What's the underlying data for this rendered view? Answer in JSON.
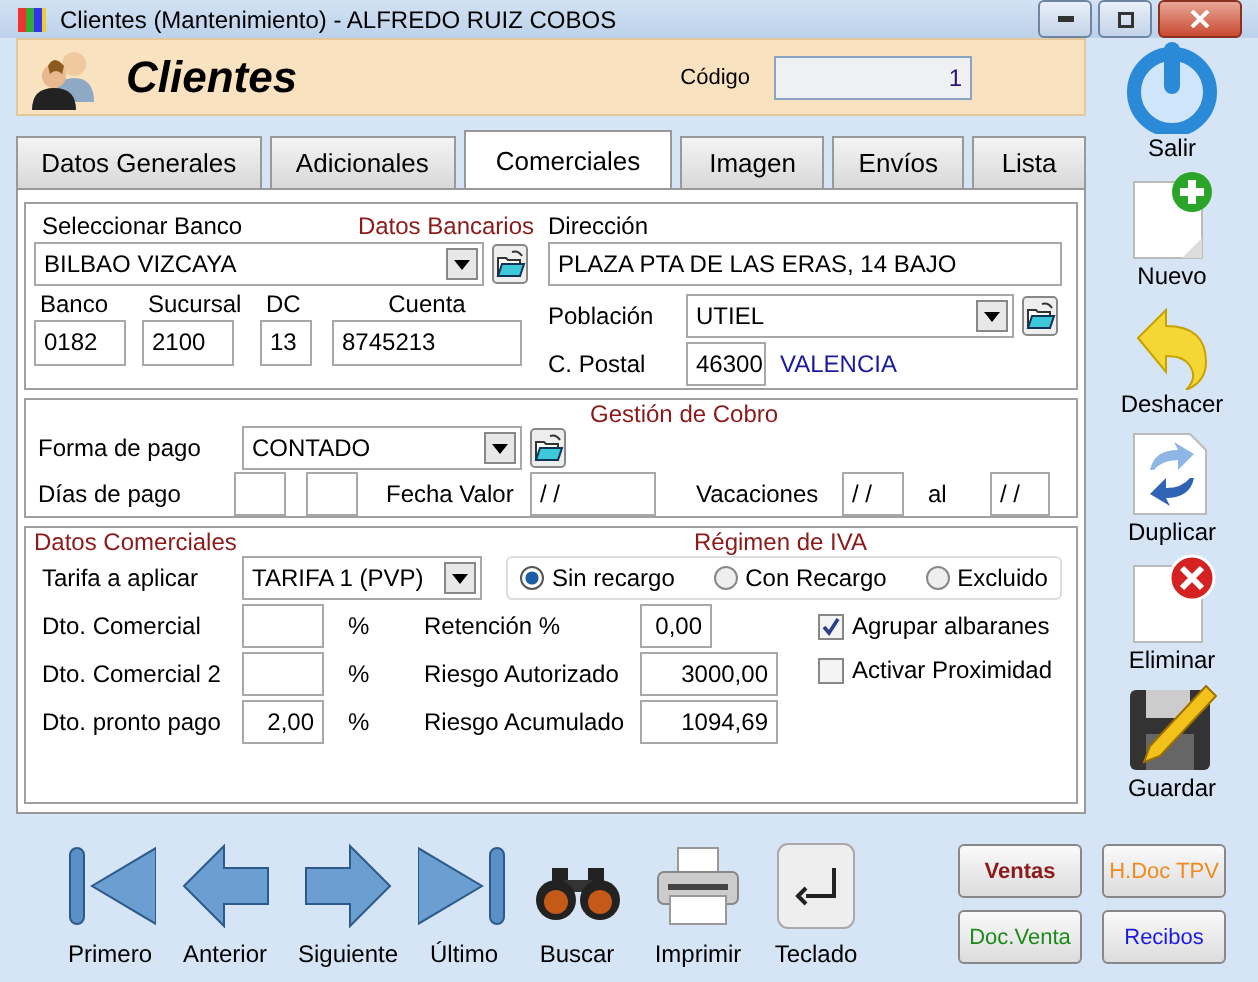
{
  "window": {
    "title": "Clientes (Mantenimiento) - ALFREDO RUIZ COBOS"
  },
  "header": {
    "title": "Clientes",
    "code_label": "Código",
    "code_value": "1"
  },
  "tabs": [
    {
      "label": "Datos Generales",
      "selected": false
    },
    {
      "label": "Adicionales",
      "selected": false
    },
    {
      "label": "Comerciales",
      "selected": true
    },
    {
      "label": "Imagen",
      "selected": false
    },
    {
      "label": "Envíos",
      "selected": false
    },
    {
      "label": "Lista",
      "selected": false
    }
  ],
  "datos_bancarios": {
    "title": "Datos Bancarios",
    "bank_label": "Seleccionar Banco",
    "bank_value": "BILBAO VIZCAYA",
    "fields": [
      {
        "label": "Banco",
        "value": "0182"
      },
      {
        "label": "Sucursal",
        "value": "2100"
      },
      {
        "label": "DC",
        "value": "13"
      },
      {
        "label": "Cuenta",
        "value": "8745213"
      }
    ],
    "address_label": "Dirección",
    "address_value": "PLAZA PTA DE LAS ERAS, 14 BAJO",
    "town_label": "Población",
    "town_value": "UTIEL",
    "postal_label": "C. Postal",
    "postal_value": "46300",
    "province": "VALENCIA"
  },
  "gestion_cobro": {
    "title": "Gestión de Cobro",
    "payment_label": "Forma de pago",
    "payment_value": "CONTADO",
    "days_label": "Días de pago",
    "date_label": "Fecha Valor",
    "date_value": "/ /",
    "vacation_label": "Vacaciones",
    "vacation_from": "/ /",
    "to_label": "al",
    "vacation_to": "/ /"
  },
  "datos_comerciales": {
    "title": "Datos Comerciales",
    "tariff_label": "Tarifa a aplicar",
    "tariff_value": "TARIFA 1 (PVP)",
    "discounts": [
      {
        "label": "Dto. Comercial",
        "unit": "%"
      },
      {
        "label": "Dto. Comercial 2",
        "unit": "%"
      },
      {
        "label": "Dto. pronto pago",
        "value": "2,00",
        "unit": "%"
      }
    ],
    "amounts": [
      {
        "label": "Retención %",
        "value": "0,00"
      },
      {
        "label": "Riesgo Autorizado",
        "value": "3000,00"
      },
      {
        "label": "Riesgo Acumulado",
        "value": "1094,69"
      }
    ],
    "iva": {
      "title": "Régimen de IVA",
      "options": [
        {
          "label": "Sin recargo",
          "selected": true
        },
        {
          "label": "Con Recargo",
          "selected": false
        },
        {
          "label": "Excluido",
          "selected": false
        }
      ]
    },
    "checks": [
      {
        "label": "Agrupar albaranes",
        "checked": true
      },
      {
        "label": "Activar Proximidad",
        "checked": false
      }
    ]
  },
  "sidebar": [
    {
      "label": "Salir",
      "kind": "exit"
    },
    {
      "label": "Nuevo",
      "kind": "new"
    },
    {
      "label": "Deshacer",
      "kind": "undo"
    },
    {
      "label": "Duplicar",
      "kind": "duplicate"
    },
    {
      "label": "Eliminar",
      "kind": "delete"
    },
    {
      "label": "Guardar",
      "kind": "save"
    }
  ],
  "navigation": [
    {
      "label": "Primero",
      "kind": "first"
    },
    {
      "label": "Anterior",
      "kind": "previous"
    },
    {
      "label": "Siguiente",
      "kind": "next"
    },
    {
      "label": "Último",
      "kind": "last"
    },
    {
      "label": "Buscar",
      "kind": "search"
    },
    {
      "label": "Imprimir",
      "kind": "print"
    },
    {
      "label": "Teclado",
      "kind": "keyboard"
    }
  ],
  "actions": [
    {
      "label": "Ventas",
      "color": "#8b1a1a"
    },
    {
      "label": "H.Doc TPV",
      "color": "#f08a1c"
    },
    {
      "label": "Doc.Venta",
      "color": "#1a8a1a"
    },
    {
      "label": "Recibos",
      "color": "#1a1ae0"
    }
  ]
}
